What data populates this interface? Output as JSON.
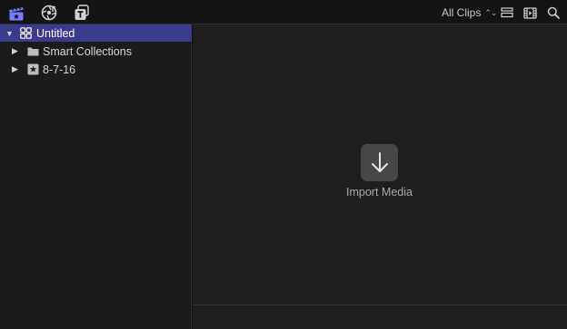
{
  "toolbar": {
    "icons": [
      "libraries-icon",
      "photos-audio-icon",
      "titles-generators-icon",
      "clip-appearance-icon",
      "filmstrip-icon",
      "search-icon"
    ],
    "filter_label": "All Clips",
    "accent_color": "#7b7bff"
  },
  "sidebar": {
    "items": [
      {
        "label": "Untitled",
        "icon": "library-icon",
        "expanded": true,
        "selected": true
      },
      {
        "label": "Smart Collections",
        "icon": "folder-icon",
        "expanded": false,
        "selected": false
      },
      {
        "label": "8-7-16",
        "icon": "event-star-icon",
        "expanded": false,
        "selected": false
      }
    ],
    "selected_color": "#3b3b8e"
  },
  "browser": {
    "import_label": "Import Media",
    "import_icon": "down-arrow-icon"
  }
}
